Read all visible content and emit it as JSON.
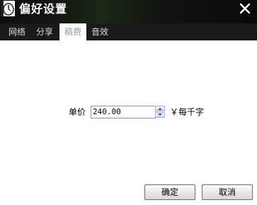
{
  "window": {
    "title": "偏好设置",
    "close_glyph": "✕"
  },
  "tabs": [
    {
      "label": "网络",
      "active": false
    },
    {
      "label": "分享",
      "active": false
    },
    {
      "label": "稿费",
      "active": true
    },
    {
      "label": "音效",
      "active": false
    }
  ],
  "fee": {
    "price_label": "单价",
    "price_value": "240.00",
    "unit_label": "￥每千字"
  },
  "buttons": {
    "ok_label": "确定",
    "cancel_label": "取消"
  },
  "icons": {
    "app": "clock-icon",
    "close": "close-icon",
    "spin_up": "spin-up-arrow-icon",
    "spin_down": "spin-down-arrow-icon"
  },
  "colors": {
    "titlebar": "#0d0d0d",
    "tabbar": "#1a1a1a",
    "active_tab_text": "#9a9a9a",
    "input_border": "#7f9db9"
  }
}
